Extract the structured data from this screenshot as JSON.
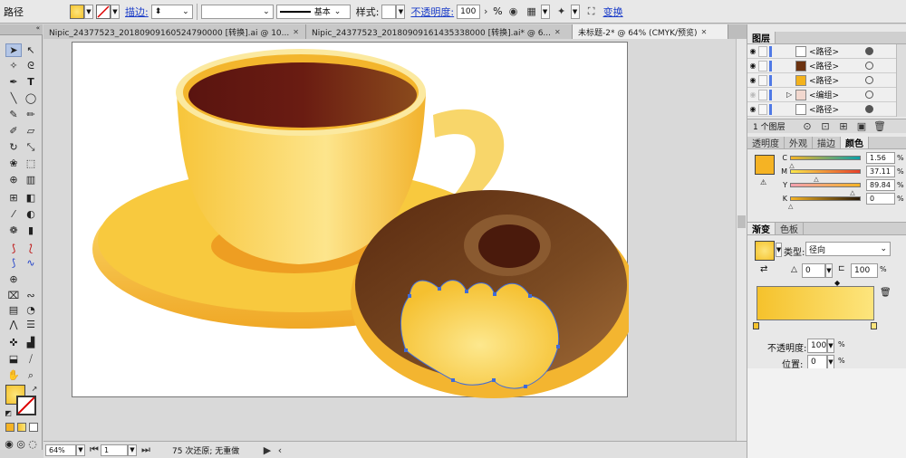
{
  "control_bar": {
    "object_type": "路径",
    "stroke_label": "描边:",
    "stroke_profile": "基本",
    "style_label": "样式:",
    "opacity_label": "不透明度:",
    "opacity_value": "100",
    "opacity_unit": "%",
    "transform_label": "变换"
  },
  "tabs": [
    {
      "label": "Nipic_24377523_20180909160524790000 [转换].ai @ 10..."
    },
    {
      "label": "Nipic_24377523_20180909161435338000 [转换].ai* @ 6..."
    },
    {
      "label": "未标题-2* @ 64% (CMYK/预览)"
    }
  ],
  "status_bar": {
    "zoom": "64%",
    "artboard": "1",
    "message": "75 次还原; 无重做"
  },
  "layers_panel": {
    "title": "图层",
    "layers": [
      {
        "name": "<路径>",
        "thumb_color": "#ffffff"
      },
      {
        "name": "<路径>",
        "thumb_color": "#6b3210"
      },
      {
        "name": "<路径>",
        "thumb_color": "#f3b21c"
      },
      {
        "name": "<编组>",
        "thumb_color": "#f2d8cf"
      },
      {
        "name": "<路径>",
        "thumb_color": "#ffffff"
      }
    ],
    "footer": "1 个图层"
  },
  "color_panel": {
    "tabs": [
      "透明度",
      "外观",
      "描边",
      "颜色"
    ],
    "active_tab": "颜色",
    "fill_color": "#f5b324",
    "channels": [
      {
        "name": "C",
        "value": "1.56",
        "caret_pct": 1.6
      },
      {
        "name": "M",
        "value": "37.11",
        "caret_pct": 37.1
      },
      {
        "name": "Y",
        "value": "89.84",
        "caret_pct": 89.8
      },
      {
        "name": "K",
        "value": "0",
        "caret_pct": 0
      }
    ],
    "unit": "%"
  },
  "gradient_panel": {
    "tabs": [
      "渐变",
      "色板"
    ],
    "active_tab": "渐变",
    "type_label": "类型:",
    "type_value": "径向",
    "angle_value": "0",
    "aspect_value": "100",
    "unit": "%",
    "opacity_label": "不透明度:",
    "opacity_value": "100",
    "location_label": "位置:",
    "location_value": "0",
    "start_color": "#f5c22c",
    "end_color": "#fde57d"
  },
  "artwork_colors": {
    "coffee_dark": "#5a1410",
    "cup_yellow": "#f7c63a",
    "donut_brown": "#6b3a18",
    "selection_blue": "#3f6bd9"
  }
}
